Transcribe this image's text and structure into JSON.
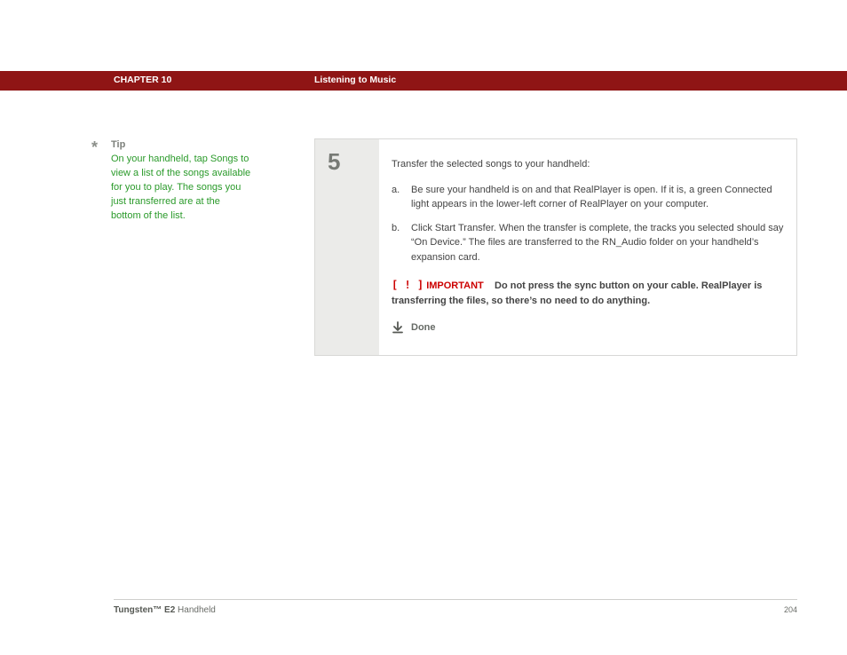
{
  "header": {
    "chapter": "CHAPTER 10",
    "title": "Listening to Music"
  },
  "tip": {
    "asterisk": "*",
    "label": "Tip",
    "text": "On your handheld, tap Songs to view a list of the songs available for you to play. The songs you just transferred are at the bottom of the list."
  },
  "step": {
    "number": "5",
    "intro": "Transfer the selected songs to your handheld:",
    "items": [
      {
        "letter": "a.",
        "text": "Be sure your handheld is on and that RealPlayer is open. If it is, a green Connected light appears in the lower-left corner of RealPlayer on your computer."
      },
      {
        "letter": "b.",
        "text": "Click Start Transfer. When the transfer is complete, the tracks you selected should say “On Device.” The files are transferred to the RN_Audio folder on your handheld’s expansion card."
      }
    ],
    "important": {
      "bracket": "[ ! ]",
      "word": "IMPORTANT",
      "text": "Do not press the sync button on your cable. RealPlayer is transferring the files, so there’s no need to do anything."
    },
    "done": "Done"
  },
  "footer": {
    "brand": "Tungsten™ E2",
    "product": " Handheld",
    "page": "204"
  }
}
